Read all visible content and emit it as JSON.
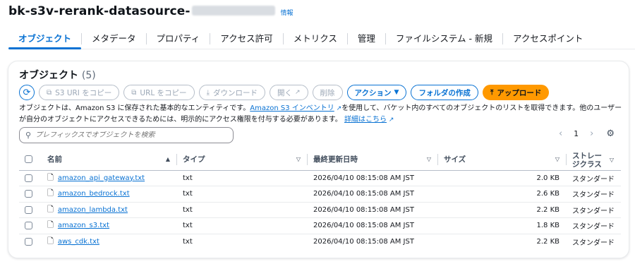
{
  "header": {
    "bucket_name": "bk-s3v-rerank-datasource-",
    "info_label": "情報"
  },
  "tabs": [
    {
      "label": "オブジェクト",
      "active": true
    },
    {
      "label": "メタデータ"
    },
    {
      "label": "プロパティ"
    },
    {
      "label": "アクセス許可"
    },
    {
      "label": "メトリクス"
    },
    {
      "label": "管理"
    },
    {
      "label": "ファイルシステム - 新規"
    },
    {
      "label": "アクセスポイント"
    }
  ],
  "objects_panel": {
    "title": "オブジェクト",
    "count": "(5)",
    "toolbar": {
      "copy_s3_uri": "S3 URI をコピー",
      "copy_url": "URL をコピー",
      "download": "ダウンロード",
      "open": "開く",
      "delete": "削除",
      "actions": "アクション",
      "create_folder": "フォルダの作成",
      "upload": "アップロード"
    },
    "description": {
      "part1": "オブジェクトは、Amazon S3 に保存された基本的なエンティティです。",
      "inventory_link": "Amazon S3 インベントリ",
      "part2": "を使用して、バケット内のすべてのオブジェクトのリストを取得できます。他のユーザーが自分のオブジェクトにアクセスできるためには、明示的にアクセス権限を付与する必要があります。",
      "details_link": "詳細はこちら"
    },
    "search": {
      "placeholder": "プレフィックスでオブジェクトを検索"
    },
    "pagination": {
      "page": "1"
    },
    "columns": {
      "name": "名前",
      "type": "タイプ",
      "modified": "最終更新日時",
      "size": "サイズ",
      "storage_class_1": "ストレー",
      "storage_class_2": "ジクラス"
    },
    "rows": [
      {
        "name": "amazon_api_gateway.txt",
        "type": "txt",
        "modified": "2026/04/10 08:15:08 AM JST",
        "size": "2.0 KB",
        "storage": "スタンダード"
      },
      {
        "name": "amazon_bedrock.txt",
        "type": "txt",
        "modified": "2026/04/10 08:15:08 AM JST",
        "size": "2.6 KB",
        "storage": "スタンダード"
      },
      {
        "name": "amazon_lambda.txt",
        "type": "txt",
        "modified": "2026/04/10 08:15:08 AM JST",
        "size": "2.2 KB",
        "storage": "スタンダード"
      },
      {
        "name": "amazon_s3.txt",
        "type": "txt",
        "modified": "2026/04/10 08:15:08 AM JST",
        "size": "1.8 KB",
        "storage": "スタンダード"
      },
      {
        "name": "aws_cdk.txt",
        "type": "txt",
        "modified": "2026/04/10 08:15:08 AM JST",
        "size": "2.2 KB",
        "storage": "スタンダード"
      }
    ]
  },
  "colors": {
    "accent": "#0972d3",
    "primary_button": "#ff9900",
    "disabled": "#9ba7b6"
  }
}
